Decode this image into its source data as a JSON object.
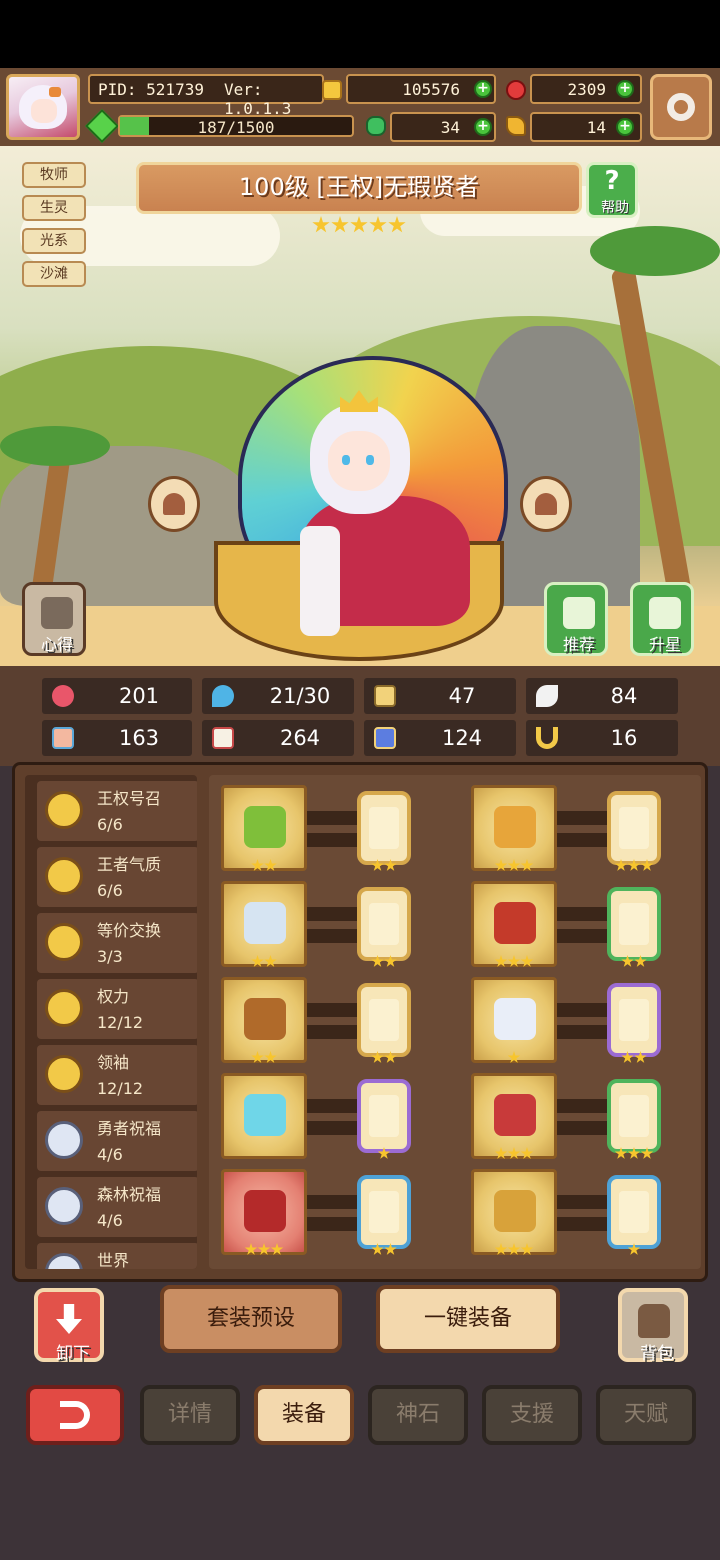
{
  "header": {
    "pid": "PID: 521739",
    "version": "Ver: 1.0.1.3",
    "gold": "105576",
    "rubies": "2309",
    "clover": "34",
    "horn": "14",
    "exp": "187/1500",
    "exp_fraction": 0.125
  },
  "tags": [
    "牧师",
    "生灵",
    "光系",
    "沙滩"
  ],
  "hero": {
    "title": "100级  [王权]无瑕贤者",
    "star_count": 5,
    "help_label": "帮助"
  },
  "scene_buttons": {
    "notes": "心得",
    "recommend": "推荐",
    "upgrade_star": "升星"
  },
  "stats": [
    {
      "icon": "heart-icon",
      "value": "201"
    },
    {
      "icon": "mana-drop-icon",
      "value": "21/30"
    },
    {
      "icon": "shield-icon",
      "value": "47"
    },
    {
      "icon": "feather-icon",
      "value": "84"
    },
    {
      "icon": "fist-icon",
      "value": "163"
    },
    {
      "icon": "book-icon",
      "value": "264"
    },
    {
      "icon": "boot-icon",
      "value": "124"
    },
    {
      "icon": "horseshoe-icon",
      "value": "16"
    }
  ],
  "skills": [
    {
      "name": "王权号召",
      "count": "6/6"
    },
    {
      "name": "王者气质",
      "count": "6/6"
    },
    {
      "name": "等价交换",
      "count": "3/3"
    },
    {
      "name": "权力",
      "count": "12/12"
    },
    {
      "name": "领袖",
      "count": "12/12"
    },
    {
      "name": "勇者祝福",
      "count": "4/6"
    },
    {
      "name": "森林祝福",
      "count": "4/6"
    },
    {
      "name": "世界",
      "count": ""
    }
  ],
  "equipment": [
    {
      "item": "scepter-icon",
      "item_stars": 2,
      "gem_stars": 2
    },
    {
      "item": "ring-icon",
      "item_stars": 3,
      "gem_stars": 3
    },
    {
      "item": "helmet-icon",
      "item_stars": 2,
      "gem_stars": 2
    },
    {
      "item": "armor-icon",
      "item_stars": 3,
      "gem_stars": 2
    },
    {
      "item": "necklace-icon",
      "item_stars": 2,
      "gem_stars": 2
    },
    {
      "item": "pet-icon",
      "item_stars": 1,
      "gem_stars": 2
    },
    {
      "item": "orb-icon",
      "item_stars": 0,
      "gem_stars": 1
    },
    {
      "item": "belt-icon",
      "item_stars": 3,
      "gem_stars": 3
    },
    {
      "item": "bowl-icon",
      "item_stars": 3,
      "gem_stars": 2
    },
    {
      "item": "boots-icon",
      "item_stars": 3,
      "gem_stars": 1
    }
  ],
  "actions": {
    "unequip": "卸下",
    "preset": "套装预设",
    "equip_all": "一键装备",
    "backpack": "背包"
  },
  "tabs": [
    "详情",
    "装备",
    "神石",
    "支援",
    "天赋"
  ],
  "active_tab": "装备"
}
